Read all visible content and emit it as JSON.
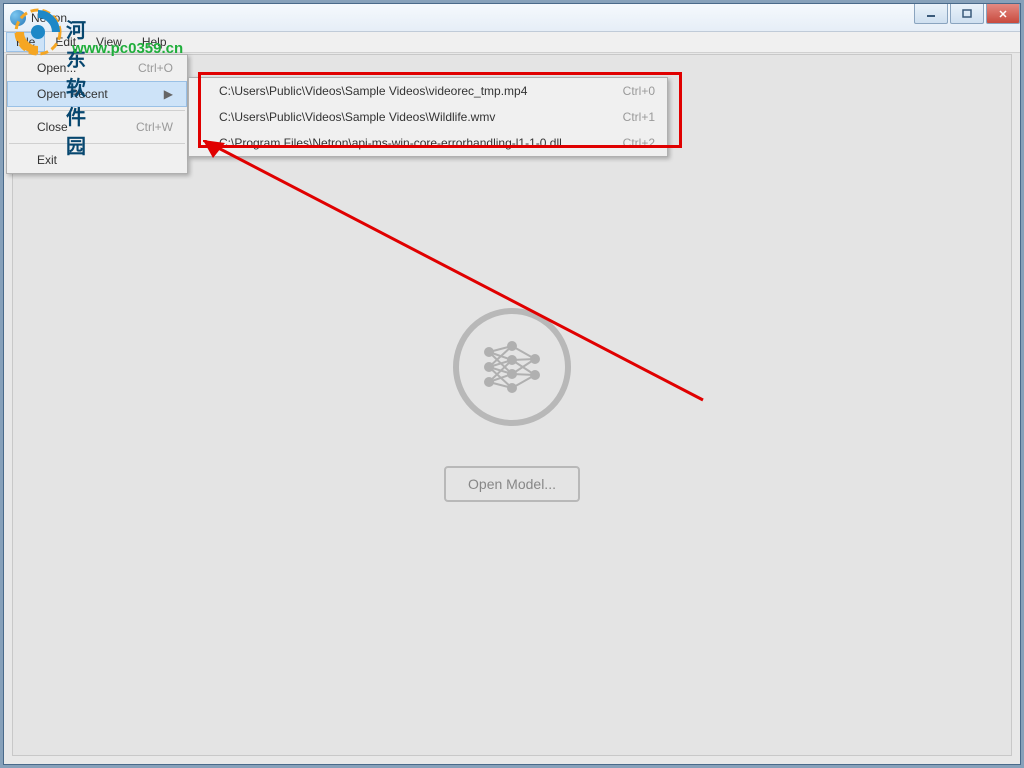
{
  "window": {
    "title": "Netron"
  },
  "menubar": [
    "File",
    "Edit",
    "View",
    "Help"
  ],
  "file_menu": {
    "open": {
      "label": "Open...",
      "shortcut": "Ctrl+O"
    },
    "open_recent": {
      "label": "Open Recent"
    },
    "close": {
      "label": "Close",
      "shortcut": "Ctrl+W"
    },
    "exit": {
      "label": "Exit"
    }
  },
  "recent": [
    {
      "path": "C:\\Users\\Public\\Videos\\Sample Videos\\videorec_tmp.mp4",
      "shortcut": "Ctrl+0"
    },
    {
      "path": "C:\\Users\\Public\\Videos\\Sample Videos\\Wildlife.wmv",
      "shortcut": "Ctrl+1"
    },
    {
      "path": "C:\\Program Files\\Netron\\api-ms-win-core-errorhandling-l1-1-0.dll",
      "shortcut": "Ctrl+2"
    }
  ],
  "main": {
    "open_model": "Open Model..."
  },
  "watermark": {
    "line1": "河东软件园",
    "line2": "www.pc0359.cn"
  }
}
